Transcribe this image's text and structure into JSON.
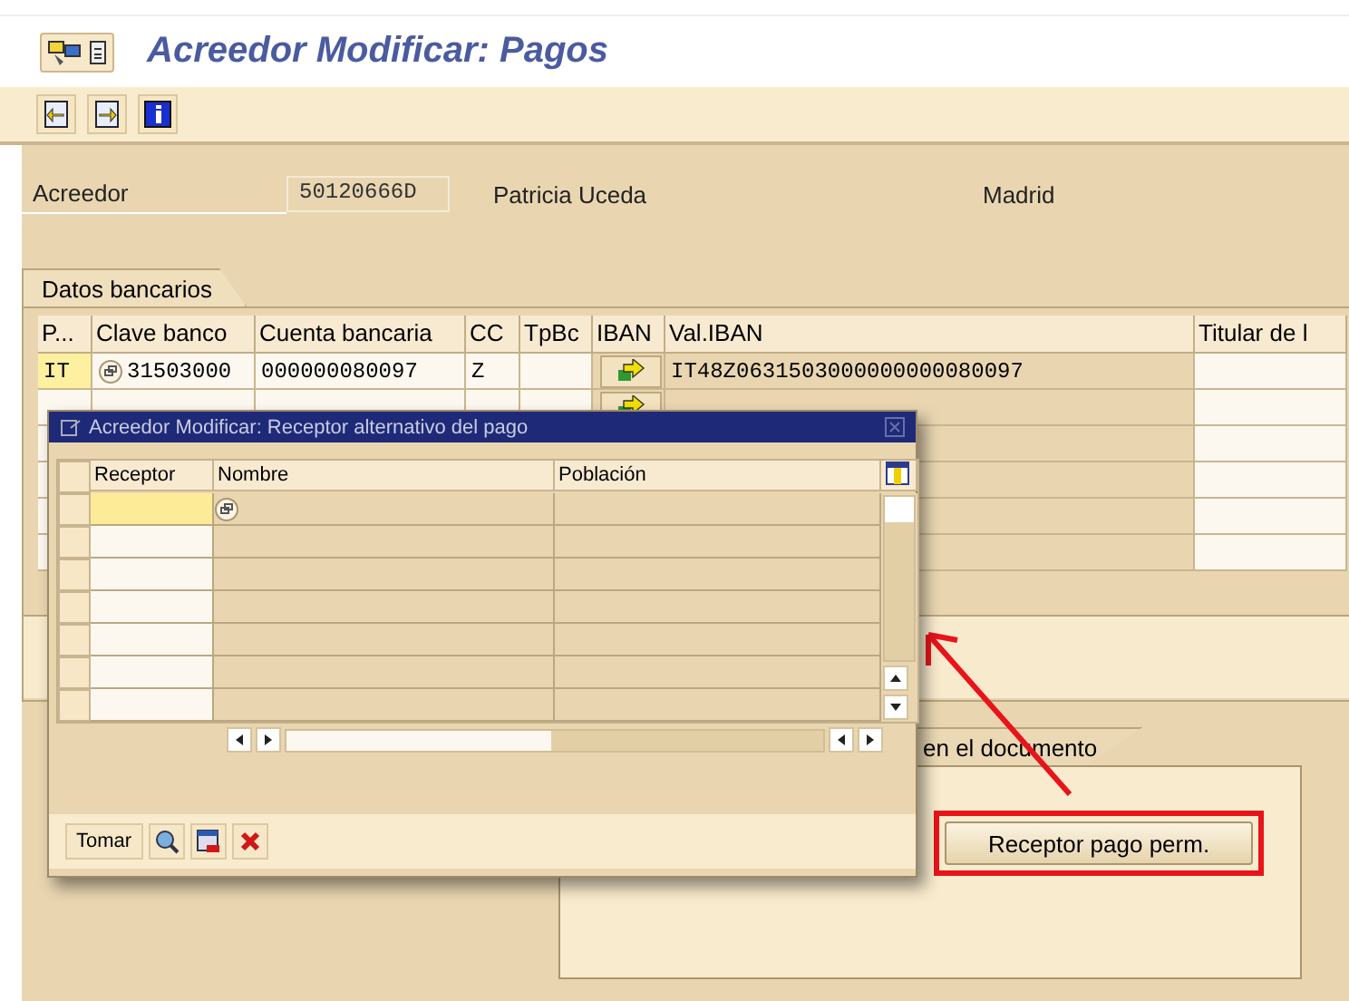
{
  "header": {
    "title": "Acreedor Modificar: Pagos"
  },
  "vendor": {
    "label": "Acreedor",
    "number": "50120666D",
    "name": "Patricia Uceda",
    "city": "Madrid"
  },
  "bank_tab": {
    "label": "Datos bancarios"
  },
  "bank_table": {
    "columns": [
      "P...",
      "Clave banco",
      "Cuenta bancaria",
      "CC",
      "TpBc",
      "IBAN",
      "Val.IBAN",
      "Titular de l"
    ],
    "rows": [
      {
        "country": "IT",
        "bank_key": "31503000",
        "account": "000000080097",
        "cc": "Z",
        "iban_button": true,
        "iban": "IT48Z0631503000000000080097",
        "focused": true
      },
      {
        "iban_button": true,
        "focused": false
      },
      {
        "focused": false
      },
      {
        "focused": false
      },
      {
        "focused": false
      },
      {
        "focused": false
      }
    ]
  },
  "payment_tab": {
    "label": "en el documento",
    "button": "Receptor pago perm."
  },
  "dialog": {
    "title": "Acreedor Modificar: Receptor alternativo del pago",
    "columns": [
      "Receptor",
      "Nombre",
      "Población"
    ],
    "rows": [
      {
        "focused": true
      },
      {
        "focused": false
      },
      {
        "focused": false
      },
      {
        "focused": false
      },
      {
        "focused": false
      },
      {
        "focused": false
      },
      {
        "focused": false
      }
    ],
    "action_button": "Tomar"
  }
}
